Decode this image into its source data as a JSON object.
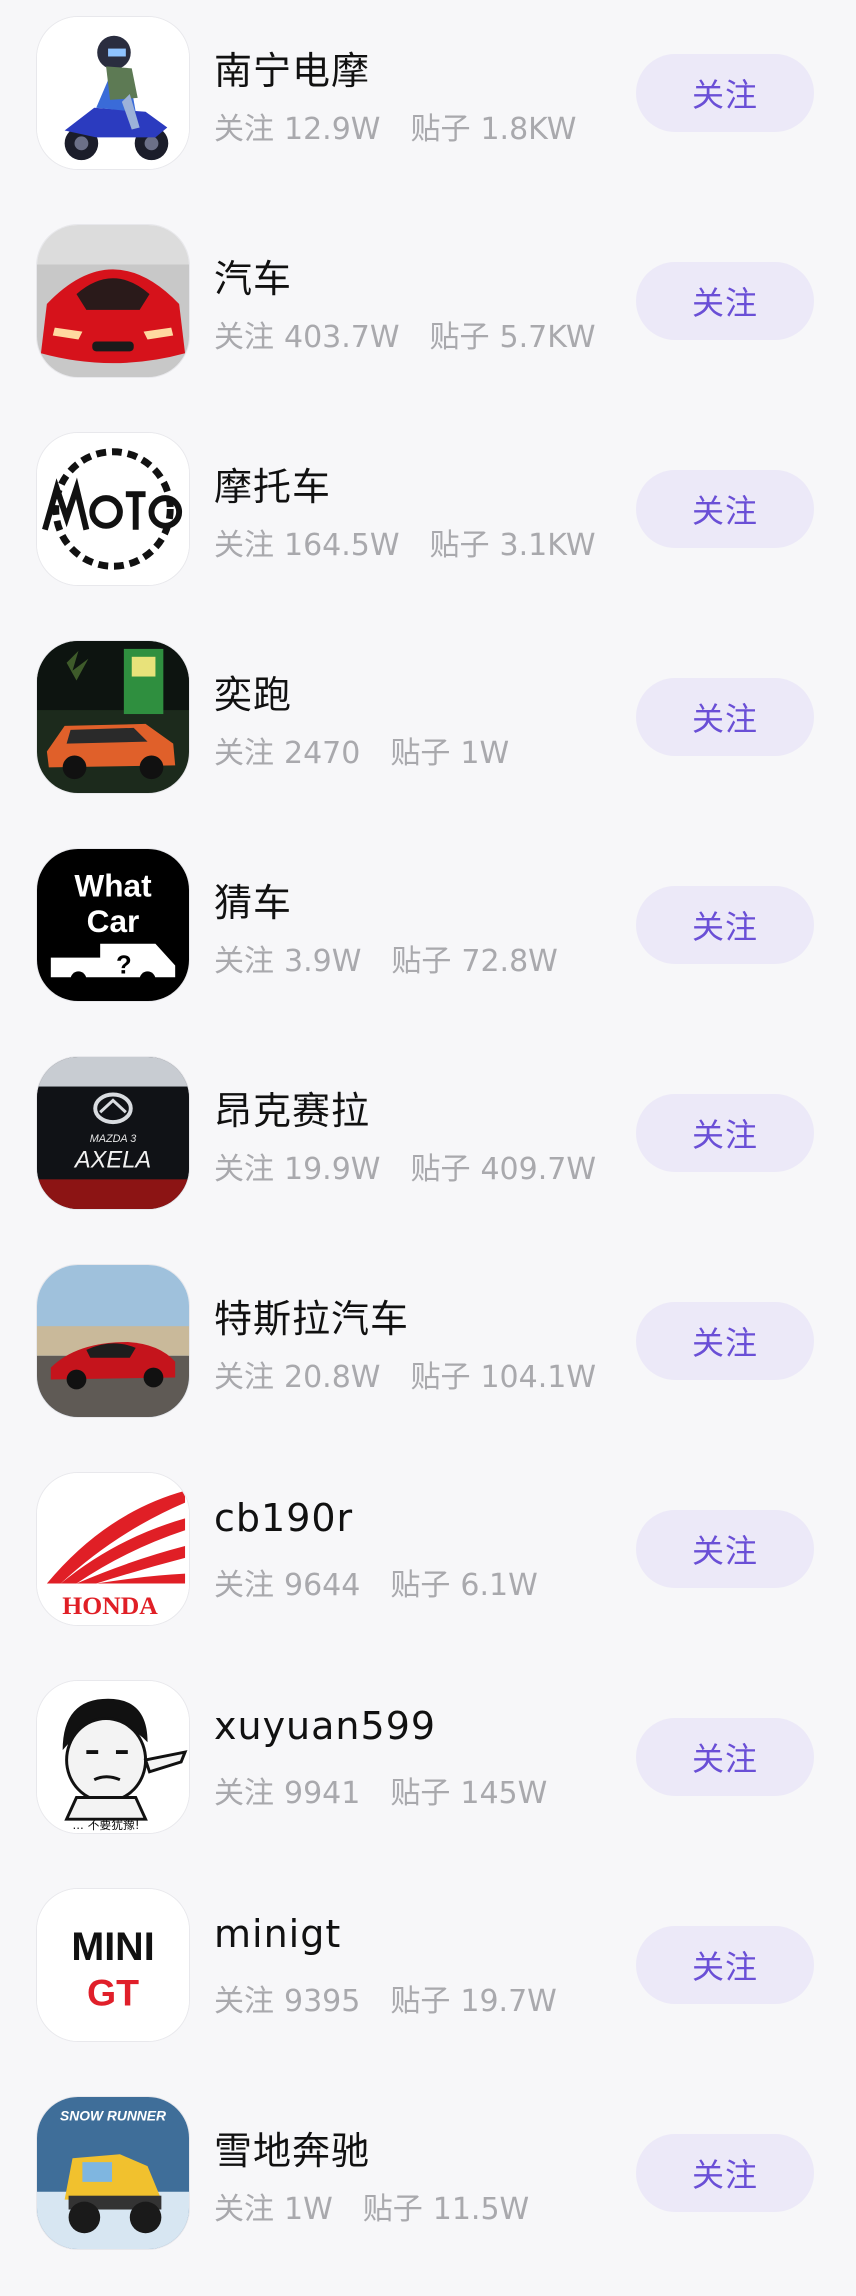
{
  "labels": {
    "follow_prefix": "关注",
    "posts_prefix": "贴子"
  },
  "items": [
    {
      "name": "南宁电摩",
      "followers": "12.9W",
      "posts": "1.8KW",
      "button": "关注",
      "icon": "motorcycle-rider-icon"
    },
    {
      "name": "汽车",
      "followers": "403.7W",
      "posts": "5.7KW",
      "button": "关注",
      "icon": "red-sports-car-icon"
    },
    {
      "name": "摩托车",
      "followers": "164.5W",
      "posts": "3.1KW",
      "button": "关注",
      "icon": "moto-logo-icon"
    },
    {
      "name": "奕跑",
      "followers": "2470",
      "posts": "1W",
      "button": "关注",
      "icon": "orange-suv-icon"
    },
    {
      "name": "猜车",
      "followers": "3.9W",
      "posts": "72.8W",
      "button": "关注",
      "icon": "what-car-logo-icon",
      "icon_text": [
        "What",
        "Car"
      ]
    },
    {
      "name": "昂克赛拉",
      "followers": "19.9W",
      "posts": "409.7W",
      "button": "关注",
      "icon": "mazda-axela-icon",
      "icon_text": [
        "MAZDA 3",
        "AXELA"
      ]
    },
    {
      "name": "特斯拉汽车",
      "followers": "20.8W",
      "posts": "104.1W",
      "button": "关注",
      "icon": "tesla-roadster-icon"
    },
    {
      "name": "cb190r",
      "followers": "9644",
      "posts": "6.1W",
      "button": "关注",
      "icon": "honda-wing-icon",
      "icon_text": [
        "HONDA"
      ]
    },
    {
      "name": "xuyuan599",
      "followers": "9941",
      "posts": "145W",
      "button": "关注",
      "icon": "meme-face-icon",
      "icon_text": [
        "... 不要犹豫!"
      ]
    },
    {
      "name": "minigt",
      "followers": "9395",
      "posts": "19.7W",
      "button": "关注",
      "icon": "mini-gt-logo-icon",
      "icon_text": [
        "MINI",
        "GT"
      ]
    },
    {
      "name": "雪地奔驰",
      "followers": "1W",
      "posts": "11.5W",
      "button": "关注",
      "icon": "snowrunner-truck-icon",
      "icon_text": [
        "SNOW",
        "RUNNER"
      ]
    }
  ],
  "colors": {
    "background": "#f7f7f9",
    "button_bg": "#ece9f8",
    "button_text": "#6a4fd6",
    "meta_text": "#a9a9ad"
  }
}
